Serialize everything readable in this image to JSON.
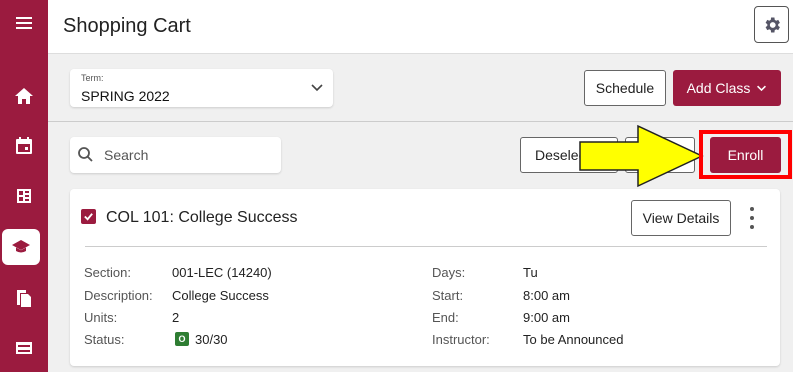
{
  "header": {
    "title": "Shopping Cart"
  },
  "sidebar": {
    "items": [
      {
        "icon": "menu-icon"
      },
      {
        "icon": "home-icon"
      },
      {
        "icon": "calendar-icon"
      },
      {
        "icon": "schedule-icon"
      },
      {
        "icon": "graduation-cap-icon",
        "active": true
      },
      {
        "icon": "documents-icon"
      },
      {
        "icon": "credit-card-icon"
      }
    ]
  },
  "term": {
    "label": "Term:",
    "value": "SPRING 2022"
  },
  "actions": {
    "schedule_label": "Schedule",
    "add_class_label": "Add Class"
  },
  "search": {
    "placeholder": "Search"
  },
  "toolbar": {
    "deselect_label": "Deselec",
    "partial_label": "e",
    "enroll_label": "Enroll"
  },
  "course": {
    "title": "COL 101: College Success",
    "view_details_label": "View Details",
    "fields_left": [
      {
        "label": "Section:",
        "value": "001-LEC (14240)"
      },
      {
        "label": "Description:",
        "value": "College Success"
      },
      {
        "label": "Units:",
        "value": "2"
      },
      {
        "label": "Status:",
        "value": "30/30",
        "badge": "O"
      }
    ],
    "fields_right": [
      {
        "label": "Days:",
        "value": "Tu"
      },
      {
        "label": "Start:",
        "value": "8:00 am"
      },
      {
        "label": "End:",
        "value": "9:00 am"
      },
      {
        "label": "Instructor:",
        "value": "To be Announced"
      }
    ]
  },
  "colors": {
    "brand": "#9b1b3f",
    "status_open": "#2e7d32",
    "arrow": "#ffff00",
    "highlight": "#ff0000"
  }
}
